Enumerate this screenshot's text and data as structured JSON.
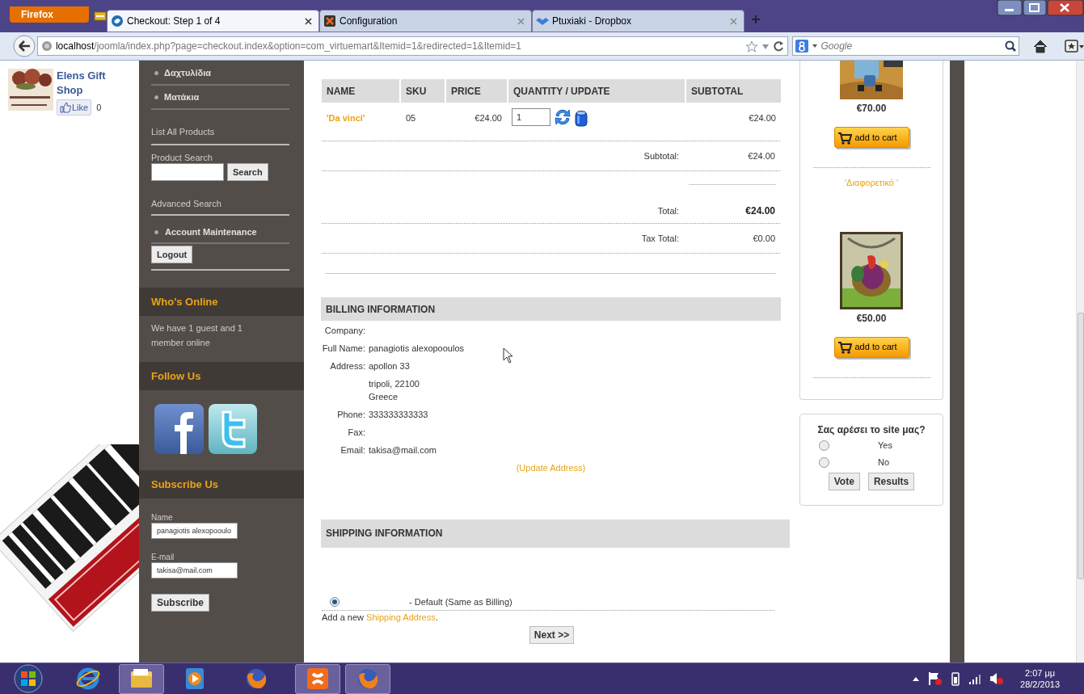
{
  "browser": {
    "menu_button": "Firefox",
    "tabs": [
      {
        "title": "Checkout: Step 1 of 4",
        "selected": true
      },
      {
        "title": "Configuration",
        "selected": false
      },
      {
        "title": "Ptuxiaki - Dropbox",
        "selected": false
      }
    ],
    "address": {
      "host": "localhost",
      "path": "/joomla/index.php?page=checkout.index&option=com_virtuemart&Itemid=1&redirected=1&Itemid=1"
    },
    "search": {
      "placeholder": "Google"
    }
  },
  "shop": {
    "name": "Elens Gift Shop",
    "like": "Like",
    "like_count": "0"
  },
  "sidebar": {
    "categories": [
      "Δαχτυλίδια",
      "Ματάκια"
    ],
    "list_all": "List All Products",
    "search": {
      "label": "Product Search",
      "button": "Search"
    },
    "advanced": "Advanced Search",
    "account": "Account Maintenance",
    "logout": "Logout",
    "whos_online": {
      "title": "Who's Online",
      "text": "We have 1 guest and 1 member online"
    },
    "follow": {
      "title": "Follow Us"
    },
    "subscribe": {
      "title": "Subscribe Us",
      "name_label": "Name",
      "name_value": "panagiotis alexopooulo",
      "email_label": "E-mail",
      "email_value": "takisa@mail.com",
      "button": "Subscribe"
    }
  },
  "cart": {
    "columns": [
      "NAME",
      "SKU",
      "PRICE",
      "QUANTITY / UPDATE",
      "SUBTOTAL"
    ],
    "rows": [
      {
        "name": "'Da vinci'",
        "sku": "05",
        "price": "€24.00",
        "quantity": "1",
        "subtotal": "€24.00"
      }
    ],
    "summary": [
      {
        "label": "Subtotal:",
        "value": "€24.00",
        "bold": false
      },
      {
        "label": "Total:",
        "value": "€24.00",
        "bold": true
      },
      {
        "label": "Tax Total:",
        "value": "€0.00",
        "bold": false
      }
    ]
  },
  "billing": {
    "title": "BILLING INFORMATION",
    "fields": [
      {
        "label": "Company:"
      },
      {
        "label": "Full Name:",
        "lines": [
          "panagiotis alexopooulos"
        ]
      },
      {
        "label": "Address:",
        "lines": [
          "apollon 33",
          "tripoli, 22100",
          "Greece"
        ]
      },
      {
        "label": "Phone:",
        "lines": [
          "333333333333"
        ]
      },
      {
        "label": "Fax:"
      },
      {
        "label": "Email:",
        "lines": [
          "takisa@mail.com"
        ]
      }
    ],
    "update_link": "(Update Address)"
  },
  "shipping": {
    "title": "SHIPPING INFORMATION",
    "options": [
      {
        "label": "- Default (Same as Billing)",
        "selected": true
      }
    ],
    "add_new": {
      "before": "Add a new",
      "link": "Shipping Address",
      "after": "."
    },
    "next": "Next >>"
  },
  "products": [
    {
      "price": "€70.00",
      "button": "add to cart"
    },
    {
      "name": "'Διαφορετικό '",
      "price": "€50.00",
      "button": "add to cart"
    }
  ],
  "poll": {
    "question": "Σας αρέσει το site μας?",
    "options": [
      {
        "label": "Yes",
        "selected": false
      },
      {
        "label": "No",
        "selected": false
      }
    ],
    "buttons": [
      "Vote",
      "Results"
    ]
  },
  "taskbar": {
    "apps": [
      {
        "kind": "ie",
        "open": false
      },
      {
        "kind": "explorer",
        "open": true
      },
      {
        "kind": "media",
        "open": false
      },
      {
        "kind": "firefox",
        "open": false
      },
      {
        "kind": "xampp",
        "open": true
      },
      {
        "kind": "firefox",
        "open": true
      }
    ],
    "time": "2:07 μμ",
    "date": "28/2/2013"
  }
}
